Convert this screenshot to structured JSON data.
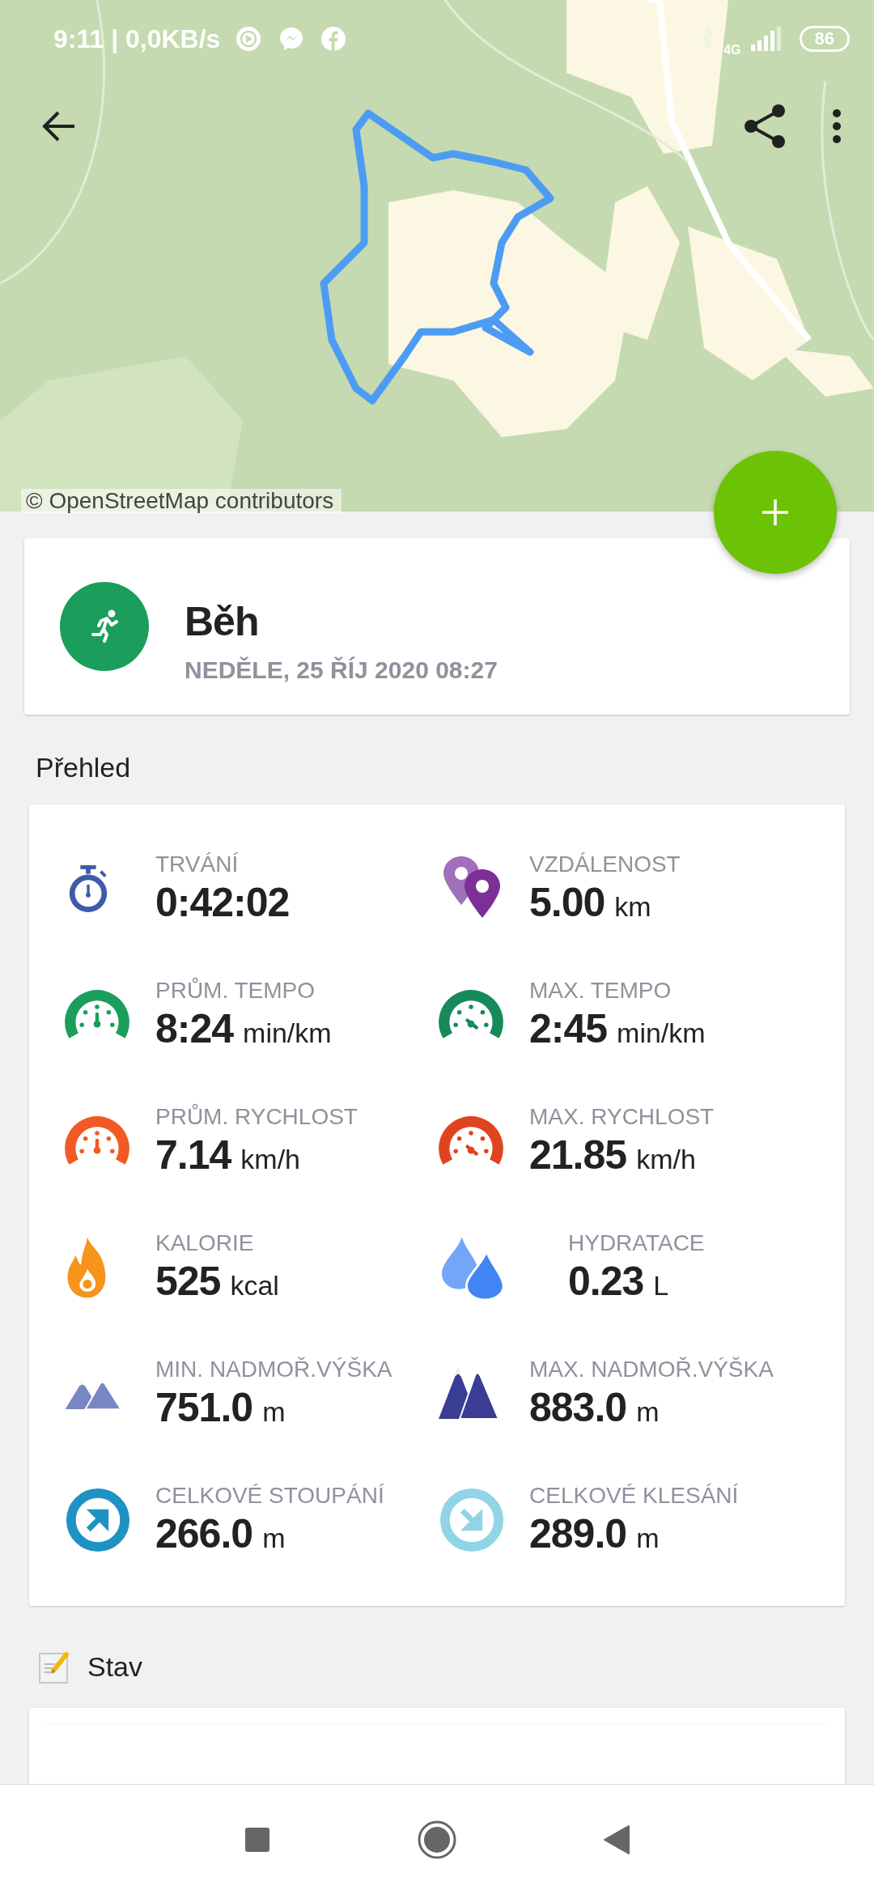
{
  "status_bar": {
    "time": "9:11 | 0,0KB/s",
    "network": "4G",
    "battery": "86"
  },
  "map": {
    "kind": "picture",
    "attribution": "© OpenStreetMap contributors"
  },
  "activity": {
    "name": "Běh",
    "date": "NEDĚLE, 25 ŘÍJ 2020 08:27"
  },
  "overview": {
    "title": "Přehled",
    "stats": [
      {
        "kind": "duration",
        "label": "TRVÁNÍ",
        "value": "0:42:02"
      },
      {
        "kind": "distance",
        "label": "VZDÁLENOST",
        "value": "5.00",
        "unit": "km"
      },
      {
        "kind": "avg-pace",
        "label": "PRŮM. TEMPO",
        "value": "8:24",
        "unit": "min/km"
      },
      {
        "kind": "max-pace",
        "label": "MAX. TEMPO",
        "value": "2:45",
        "unit": "min/km"
      },
      {
        "kind": "avg-speed",
        "label": "PRŮM. RYCHLOST",
        "value": "7.14",
        "unit": "km/h"
      },
      {
        "kind": "max-speed",
        "label": "MAX. RYCHLOST",
        "value": "21.85",
        "unit": "km/h"
      },
      {
        "kind": "calories",
        "label": "KALORIE",
        "value": "525",
        "unit": "kcal"
      },
      {
        "kind": "hydration",
        "label": "HYDRATACE",
        "value": "0.23",
        "unit": "L"
      },
      {
        "kind": "min-altitude",
        "label": "MIN. NADMOŘ.VÝŠKA",
        "value": "751.0",
        "unit": "m"
      },
      {
        "kind": "max-altitude",
        "label": "MAX. NADMOŘ.VÝŠKA",
        "value": "883.0",
        "unit": "m"
      },
      {
        "kind": "ascent",
        "label": "CELKOVÉ STOUPÁNÍ",
        "value": "266.0",
        "unit": "m"
      },
      {
        "kind": "descent",
        "label": "CELKOVÉ KLESÁNÍ",
        "value": "289.0",
        "unit": "m"
      }
    ]
  },
  "notes": {
    "title": "Stav"
  }
}
